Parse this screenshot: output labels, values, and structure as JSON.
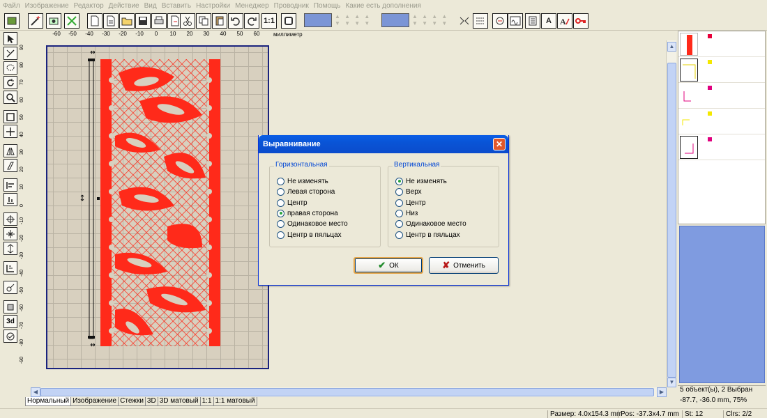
{
  "menu": [
    "Файл",
    "Изображение",
    "Редактор",
    "Действие",
    "Вид",
    "Вставить",
    "Настройки",
    "Менеджер",
    "Проводник",
    "Помощь",
    "Какие есть дополнения"
  ],
  "ruler": {
    "unit": "миллиметр",
    "top_labels": [
      "-60",
      "-50",
      "-40",
      "-30",
      "-20",
      "-10",
      "0",
      "10",
      "20",
      "30",
      "40",
      "50",
      "60"
    ],
    "left_labels": [
      "90",
      "80",
      "70",
      "60",
      "50",
      "40",
      "30",
      "20",
      "10",
      "0",
      "-10",
      "-20",
      "-30",
      "-40",
      "-50",
      "-60",
      "-70",
      "-80",
      "-90"
    ]
  },
  "toolbar": {
    "text_tool": "A",
    "ratio_label": "1:1",
    "threed_label": "3d"
  },
  "colors": {
    "swatch": "#7b95d6",
    "lace": "#ff2a1a",
    "hoop_border": "#1a237e",
    "panel_blue": "#7f9be0"
  },
  "tabs": [
    "Нормальный",
    "Изображение",
    "Стежки",
    "3D",
    "3D матовый",
    "1:1",
    "1:1 матовый"
  ],
  "object_panel": {
    "marks": [
      "#e8003a",
      "#f4e800",
      "#e0007e",
      "#f4e800",
      "#e0007e"
    ]
  },
  "status": {
    "objects": "5 объект(ы), 2 Выбран",
    "coords": "-87.7, -36.0 mm, 75%",
    "size": "Размер: 4.0x154.3 mm",
    "pos": "Pos: -37.3x4.7 mm",
    "st": "St: 12",
    "clrs": "Clrs: 2/2"
  },
  "dialog": {
    "title": "Выравнивание",
    "close": "✕",
    "horizontal": {
      "label": "Горизонтальная",
      "options": [
        "Не изменять",
        "Левая сторона",
        "Центр",
        "правая сторона",
        "Одинаковое место",
        "Центр в пяльцах"
      ],
      "selected": 3
    },
    "vertical": {
      "label": "Вертикальная",
      "options": [
        "Не изменять",
        "Верх",
        "Центр",
        "Низ",
        "Одинаковое место",
        "Центр в пяльцах"
      ],
      "selected": 0
    },
    "ok_label": "ОК",
    "cancel_label": "Отменить"
  }
}
